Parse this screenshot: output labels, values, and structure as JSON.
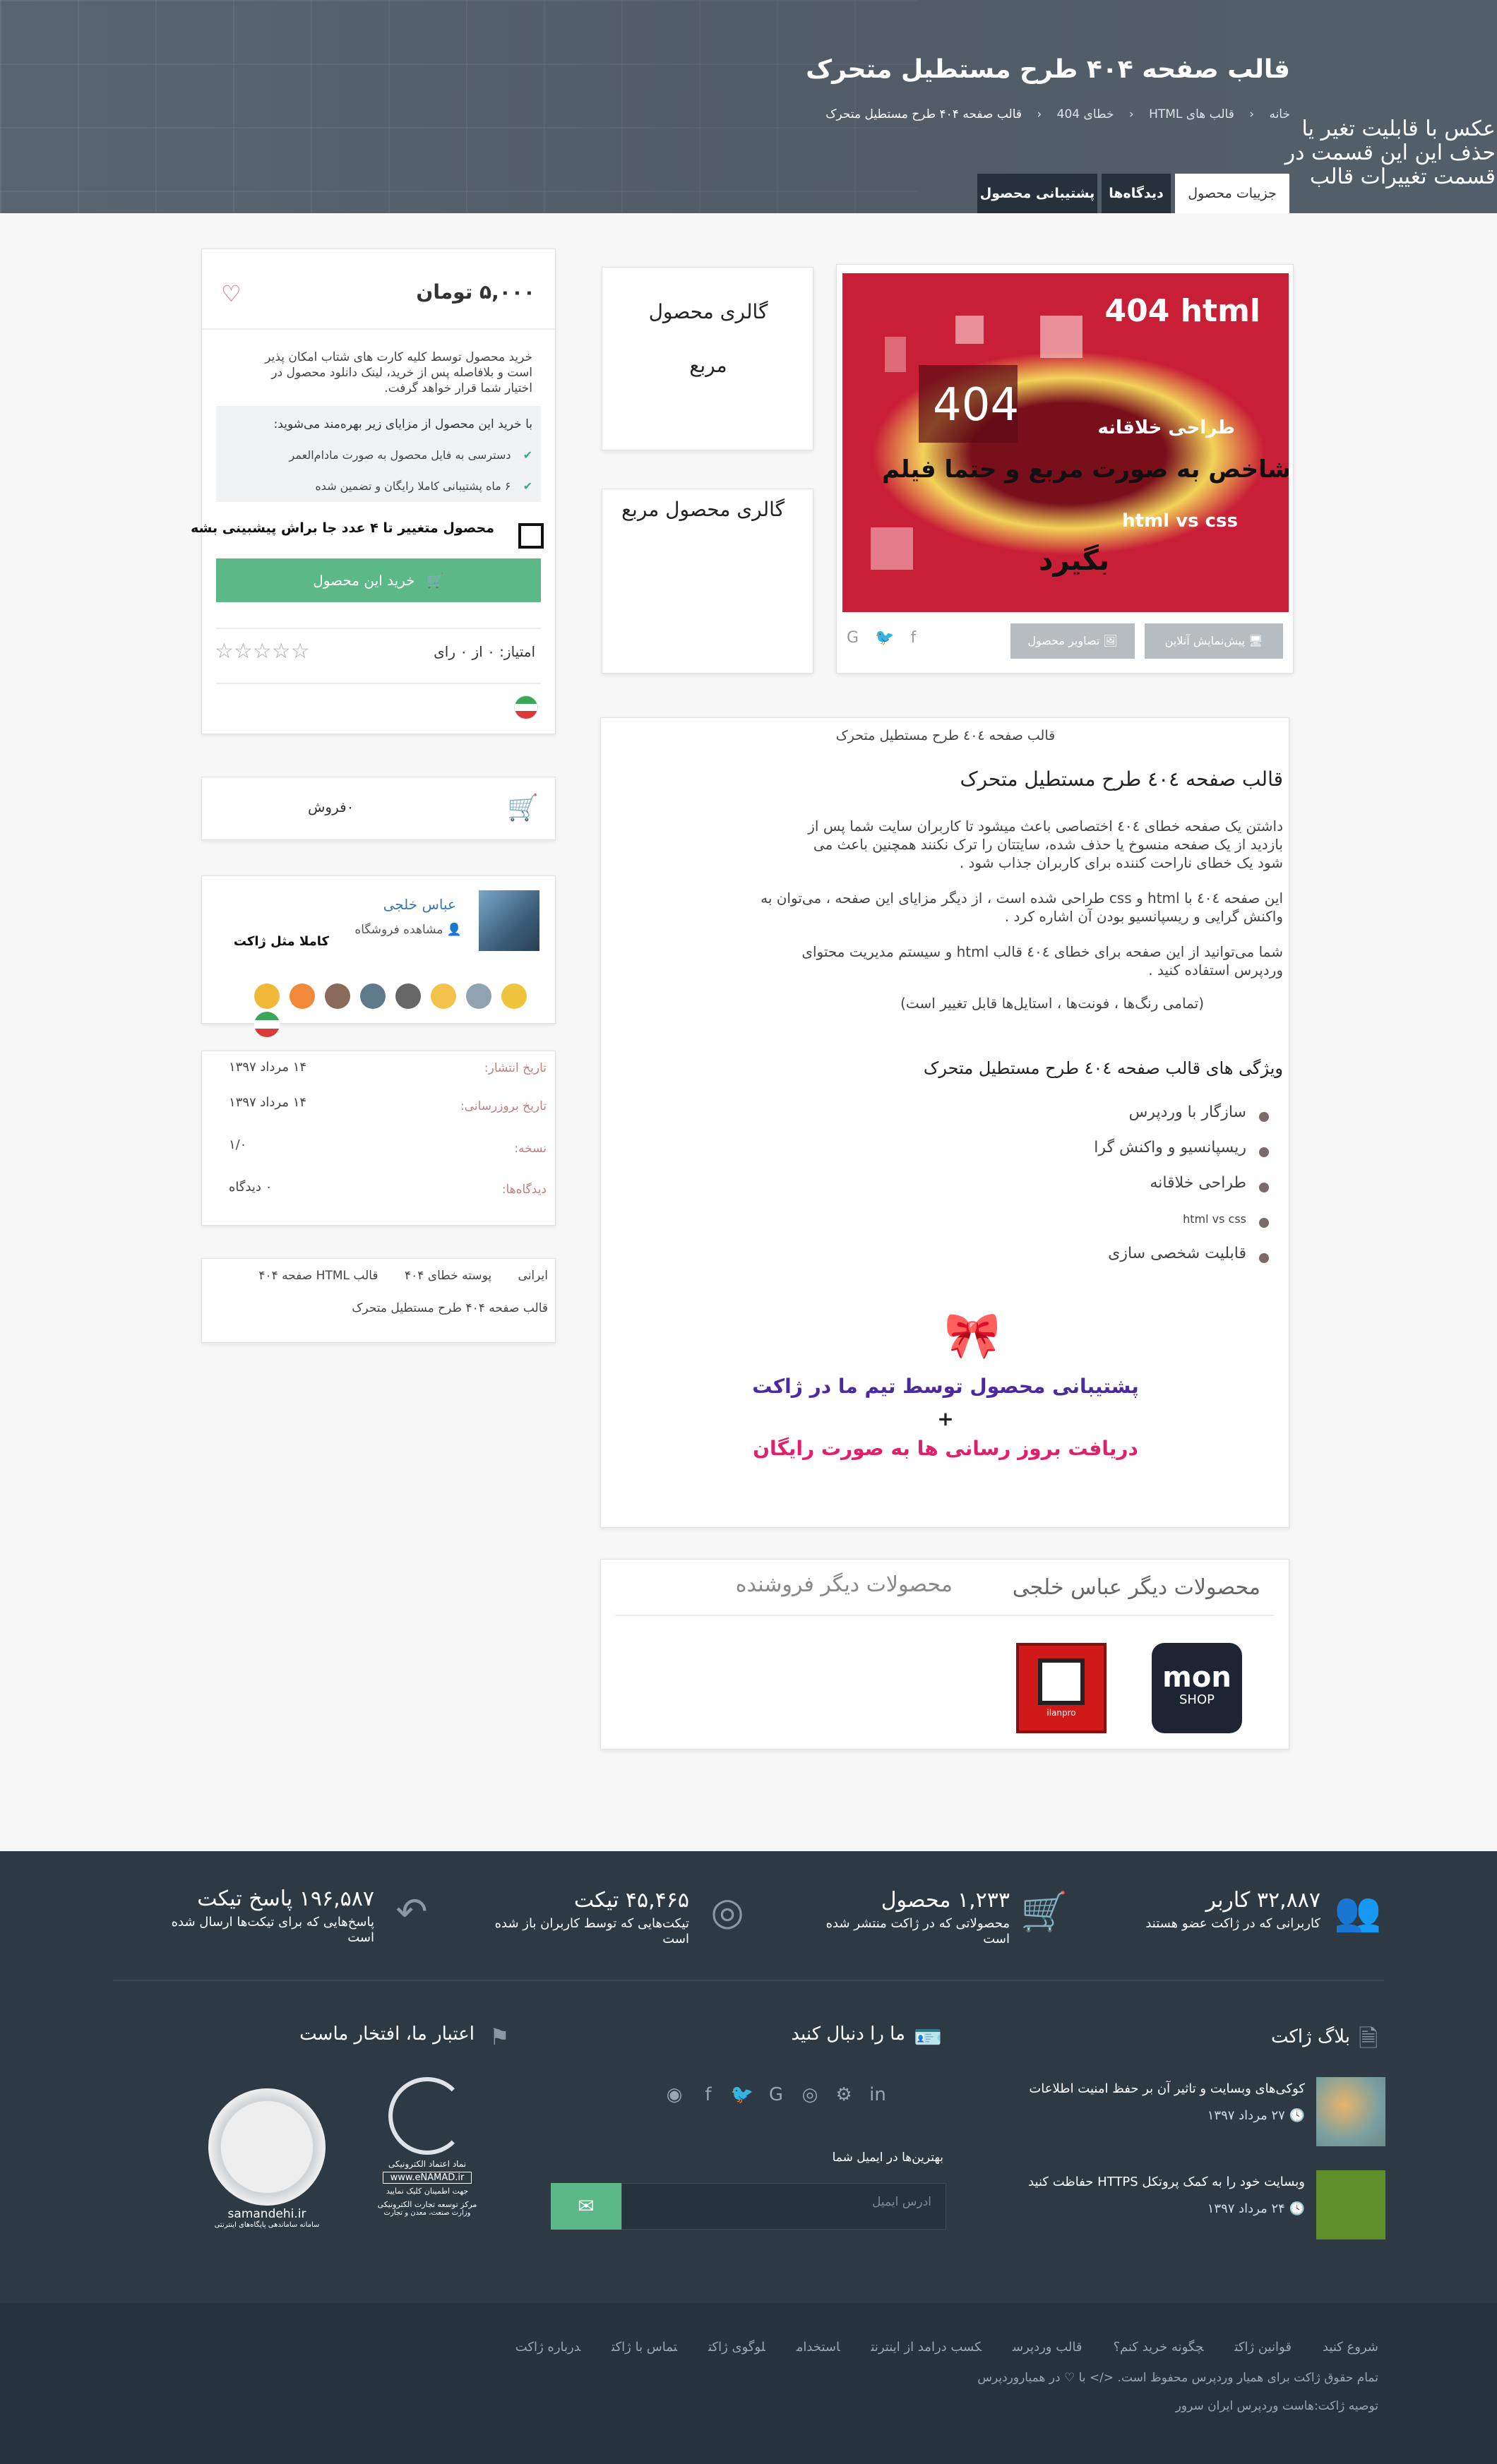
{
  "hero": {
    "title": "قالب صفحه ۴۰۴ طرح مستطیل متحرک",
    "breadcrumb": [
      "خانه",
      "قالب های HTML",
      "خطای 404",
      "قالب صفحه ۴۰۴ طرح مستطیل متحرک"
    ],
    "overlay_text": [
      "عکس با قابلیت تغیر یا",
      "حذف این این قسمت در",
      "قسمت تغییرات قالب"
    ],
    "tabs": [
      "جزییات محصول",
      "دیدگاه‌ها",
      "پشتیبانی محصول"
    ]
  },
  "gallery": {
    "main_image": {
      "line1": "404 html",
      "line2": "404",
      "line3": "طراحی خلاقانه",
      "line4": "عکس شاخص به صورت مربع و حتما فیلم",
      "line5": "html vs css",
      "line6": "بگیرد"
    },
    "btn_preview": "پیش‌نمایش آنلاین",
    "btn_images": "تصاویر محصول",
    "thumb1": [
      "گالری محصول",
      "مربع"
    ],
    "thumb2": "گالری محصول مربع"
  },
  "buy": {
    "price": "۵,۰۰۰ تومان",
    "desc": [
      "خرید محصول توسط کلیه کارت های شتاب امکان پذیر",
      "است و بلافاصله پس از خرید، لینک دانلود محصول در",
      "اختیار شما قرار خواهد گرفت."
    ],
    "benefits_title": "با خرید این محصول از مزایای زیر بهره‌مند می‌شوید:",
    "benefits": [
      "دسترسی به فایل محصول به صورت مادام‌العمر",
      "۶ ماه پشتیبانی کاملا رایگان و تضمین شده"
    ],
    "option": "محصول متغییر تا ۴ عدد جا براش پیشبینی بشه",
    "buy_btn": "خرید این محصول",
    "rating": "امتیاز: ۰ از ۰ رای"
  },
  "sales": {
    "text": "۰فروش"
  },
  "seller": {
    "name": "عباس خلجی",
    "shop": "مشاهده فروشگاه",
    "note": "کاملا مثل ژاکت"
  },
  "meta": {
    "rows": [
      {
        "label": "تاریخ انتشار:",
        "value": "۱۴ مرداد ۱۳۹۷"
      },
      {
        "label": "تاریخ بروزرسانی:",
        "value": "۱۴ مرداد ۱۳۹۷"
      },
      {
        "label": "نسخه:",
        "value": "۱/۰"
      },
      {
        "label": "دیدگاه‌ها:",
        "value": "۰ دیدگاه"
      }
    ]
  },
  "tags": {
    "items": [
      "ایرانی",
      "پوسته خطای ۴۰۴",
      "قالب HTML صفحه ۴۰۴"
    ],
    "line2": "قالب صفحه ۴۰۴ طرح مستطیل متحرک"
  },
  "content": {
    "caption": "قالب صفحه ٤٠٤ طرح مستطیل متحرک",
    "heading": "قالب صفحه ٤٠٤ طرح مستطیل متحرک",
    "p1": [
      "داشتن یک صفحه خطای ٤٠٤ اختصاصی باعث میشود تا کاربران سایت شما پس از",
      "بازدید از یک صفحه منسوخ یا حذف شده، سایتتان را ترک نکنند همچنین باعث می",
      "شود یک خطای ناراحت کننده برای کاربران جذاب شود ."
    ],
    "p2": [
      "این صفحه ٤٠٤ با html و css طراحی شده است ، از دیگر مزایای این صفحه ، می‌توان به",
      "واکنش گرایی و ریسپانسیو بودن آن اشاره کرد ."
    ],
    "p3": [
      "شما می‌توانید از این صفحه برای خطای ٤٠٤ قالب html و سیستم مدیریت محتوای",
      "وردپرس استفاده کنید ."
    ],
    "p4": "(تمامی رنگ‌ها ، فونت‌ها ، استایل‌ها قابل تغییر است)",
    "features_title": "ویژگی های قالب صفحه ٤٠٤ طرح مستطیل متحرک",
    "features": [
      "سازگار با وردپرس",
      "ریسپانسیو و واکنش گرا",
      "طراحی خلاقانه",
      "html vs css",
      "قابلیت شخصی سازی"
    ],
    "promo1": "پشتیبانی محصول توسط تیم ما در ژاکت",
    "promo_plus": "+",
    "promo2": "دریافت بروز رسانی ها به صورت رایگان"
  },
  "related": {
    "tab_active": "محصولات دیگر عباس خلجی",
    "tab_other": "محصولات دیگر فروشنده",
    "item1": [
      "mo",
      "n",
      "SHOP"
    ],
    "item2": "ilanpro"
  },
  "stats": [
    {
      "num": "۳۲,۸۸۷ کاربر",
      "sub": [
        "کاربرانی که در ژاکت عضو هستند"
      ]
    },
    {
      "num": "۱,۲۳۳ محصول",
      "sub": [
        "محصولاتی که در ژاکت منتشر شده",
        "است"
      ]
    },
    {
      "num": "۴۵,۴۶۵ تیکت",
      "sub": [
        "تیکت‌هایی که توسط کاربران باز شده",
        "است"
      ]
    },
    {
      "num": "۱۹۶,۵۸۷ پاسخ تیکت",
      "sub": [
        "پاسخ‌هایی که برای تیکت‌ها ارسال شده",
        "است"
      ]
    }
  ],
  "footer": {
    "blog_title": "بلاگ ژاکت",
    "posts": [
      {
        "title": "کوکی‌های وبسایت و تاثیر آن بر حفظ امنیت اطلاعات",
        "date": "۲۷ مرداد ۱۳۹۷"
      },
      {
        "title": "وبسایت خود را به کمک پروتکل HTTPS حفاظت کنید",
        "date": "۲۴ مرداد ۱۳۹۷"
      }
    ],
    "follow_title": "ما را دنبال کنید",
    "newsletter": "بهترین‌ها در ایمیل شما",
    "email_placeholder": "ادرس ایمیل",
    "trust_title": "اعتبار ما، افتخار ماست",
    "enamad_lines": [
      "نماد اعتماد الکترونیکی",
      "www.eNAMAD.ir",
      "جهت اطمینان کلیک نمایید",
      "مرکز توسعه تجارت الکترونیکی",
      "وزارت صنعت، معدن و تجارت"
    ],
    "samandehi": "samandehi.ir",
    "samandehi_sub": "سامانه ساماندهی پایگاه‌های اینترنتی",
    "links": [
      "شروع کنید",
      "قوانین ژاکت",
      "چگونه خرید کنم؟",
      "قالب وردپرس",
      "کسب درامد از اینترنت",
      "استخدام",
      "لوگوی ژاکت",
      "تماس با ژاکت",
      "درباره ژاکت"
    ],
    "copyright": "تمام حقوق ژاکت برای همیار وردپرس محفوظ است. </> با ♡ در همیاروردپرس",
    "hosting": "توصیه ژاکت:هاست وردپرس ایران سرور"
  }
}
